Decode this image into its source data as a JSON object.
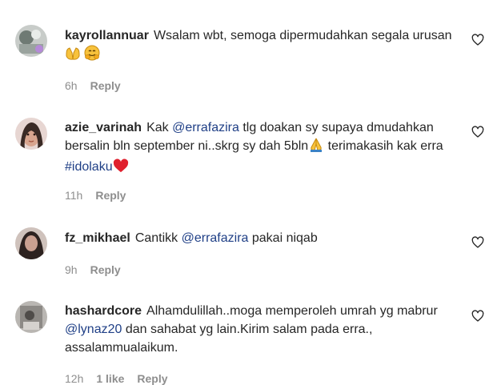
{
  "top_fragment": "· · · · · · · · · · · · ·,,",
  "comments": [
    {
      "username": "kayrollannuar",
      "text_parts": [
        "Wsalam wbt, semoga dipermudahkan segala urusan"
      ],
      "emojis": [
        "open-hands-emoji",
        "hugging-face-emoji"
      ],
      "time": "6h",
      "reply": "Reply"
    },
    {
      "username": "azie_varinah",
      "text_a": "Kak ",
      "mention": "@errafazira",
      "text_b": " tlg doakan sy supaya dmudahkan bersalin bln september ni..skrg sy dah 5bln",
      "text_c": " terimakasih kak erra ",
      "hashtag": "#idolaku",
      "emojis": [
        "folded-hands-emoji",
        "red-heart-emoji"
      ],
      "time": "11h",
      "reply": "Reply"
    },
    {
      "username": "fz_mikhael",
      "text_a": "Cantikk ",
      "mention": "@errafazira",
      "text_b": " pakai niqab",
      "time": "9h",
      "reply": "Reply"
    },
    {
      "username": "hashardcore",
      "text_a": "Alhamdulillah..moga memperoleh umrah yg mabrur ",
      "mention": "@lynaz20",
      "text_b": " dan sahabat yg lain.Kirim salam pada erra., assalammualaikum.",
      "time": "12h",
      "likes": "1 like",
      "reply": "Reply"
    }
  ],
  "colors": {
    "text": "#262626",
    "meta": "#8e8e8e",
    "link": "#1f3f86",
    "heart_stroke": "#262626"
  }
}
